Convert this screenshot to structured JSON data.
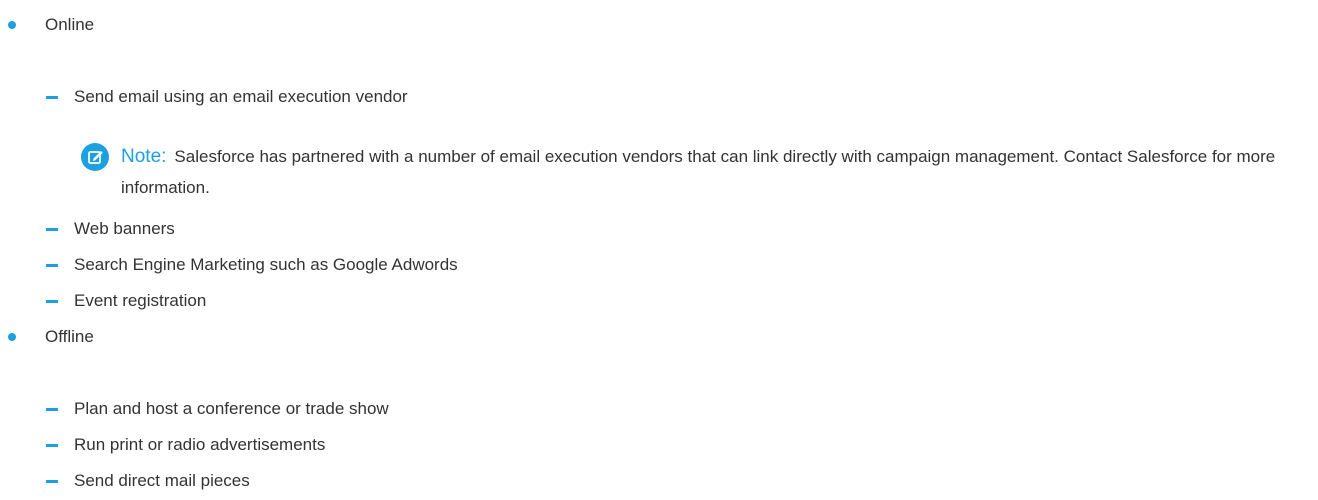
{
  "list": {
    "items": [
      {
        "label": "Online",
        "subitems": [
          "Send email using an email execution vendor",
          "Web banners",
          "Search Engine Marketing such as Google Adwords",
          "Event registration"
        ]
      },
      {
        "label": "Offline",
        "subitems": [
          "Plan and host a conference or trade show",
          "Run print or radio advertisements",
          "Send direct mail pieces"
        ]
      }
    ]
  },
  "note": {
    "label": "Note:",
    "text": "Salesforce has partnered with a number of email execution vendors that can link directly with campaign management. Contact Salesforce for more information.",
    "icon": "edit-note-icon"
  },
  "colors": {
    "accent": "#1ba0e1",
    "text": "#333333"
  }
}
